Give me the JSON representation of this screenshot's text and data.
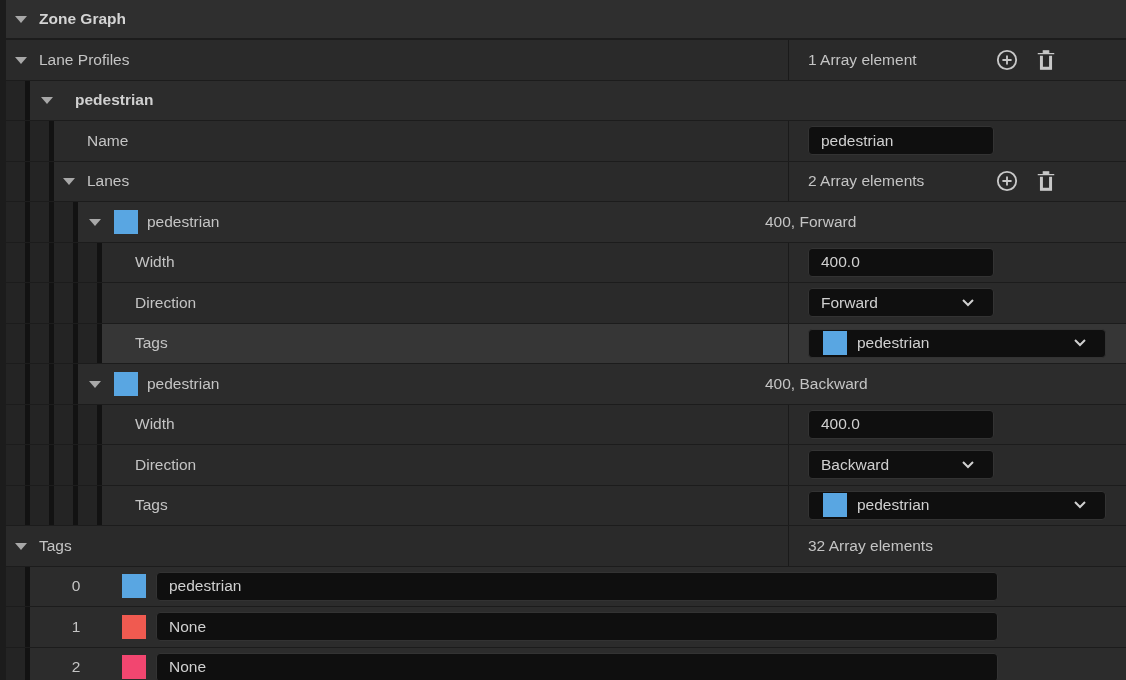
{
  "category": {
    "title": "Zone Graph",
    "expanded": true
  },
  "lane_profiles": {
    "label": "Lane Profiles",
    "expanded": true,
    "count": "1 Array element",
    "items": [
      {
        "title": "pedestrian",
        "expanded": true,
        "name": {
          "label": "Name",
          "value": "pedestrian"
        },
        "lanes": {
          "label": "Lanes",
          "expanded": true,
          "count": "2 Array elements",
          "items": [
            {
              "color": "#59a6e2",
              "label": "pedestrian",
              "summary": "400, Forward",
              "expanded": true,
              "properties": [
                {
                  "kind": "text",
                  "label": "Width",
                  "value": "400.0",
                  "highlighted": false
                },
                {
                  "kind": "dropdown",
                  "label": "Direction",
                  "value": "Forward",
                  "highlighted": false
                },
                {
                  "kind": "tag",
                  "label": "Tags",
                  "value": "pedestrian",
                  "color": "#59a6e2",
                  "highlighted": true
                }
              ]
            },
            {
              "color": "#59a6e2",
              "label": "pedestrian",
              "summary": "400, Backward",
              "expanded": true,
              "properties": [
                {
                  "kind": "text",
                  "label": "Width",
                  "value": "400.0",
                  "highlighted": false
                },
                {
                  "kind": "dropdown",
                  "label": "Direction",
                  "value": "Backward",
                  "highlighted": false
                },
                {
                  "kind": "tag",
                  "label": "Tags",
                  "value": "pedestrian",
                  "color": "#59a6e2",
                  "highlighted": false
                }
              ]
            }
          ]
        }
      }
    ]
  },
  "tags": {
    "label": "Tags",
    "expanded": true,
    "count": "32 Array elements",
    "items": [
      {
        "index": "0",
        "color": "#59a6e2",
        "value": "pedestrian"
      },
      {
        "index": "1",
        "color": "#f05a50",
        "value": "None"
      },
      {
        "index": "2",
        "color": "#f24670",
        "value": "None"
      }
    ]
  }
}
